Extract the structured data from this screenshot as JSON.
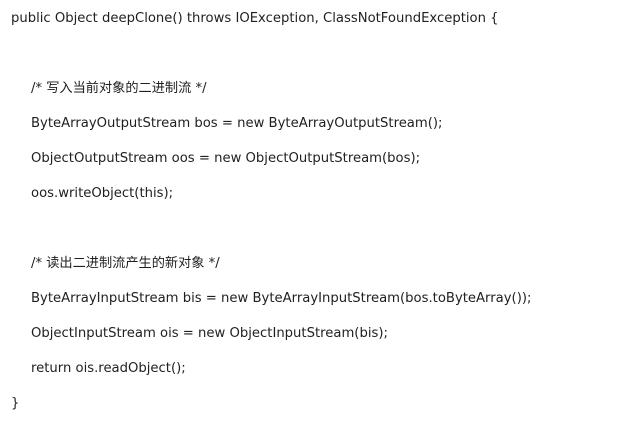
{
  "code": {
    "signature": "public Object deepClone() throws IOException, ClassNotFoundException {",
    "comment_write": "/* 写入当前对象的二进制流 */",
    "line_bos": "ByteArrayOutputStream bos = new ByteArrayOutputStream();",
    "line_oos": "ObjectOutputStream oos = new ObjectOutputStream(bos);",
    "line_write": "oos.writeObject(this);",
    "comment_read": "/* 读出二进制流产生的新对象 */",
    "line_bis": "ByteArrayInputStream bis = new ByteArrayInputStream(bos.toByteArray());",
    "line_ois": "ObjectInputStream ois = new ObjectInputStream(bis);",
    "line_return": "return ois.readObject();",
    "closing_brace": "}"
  }
}
